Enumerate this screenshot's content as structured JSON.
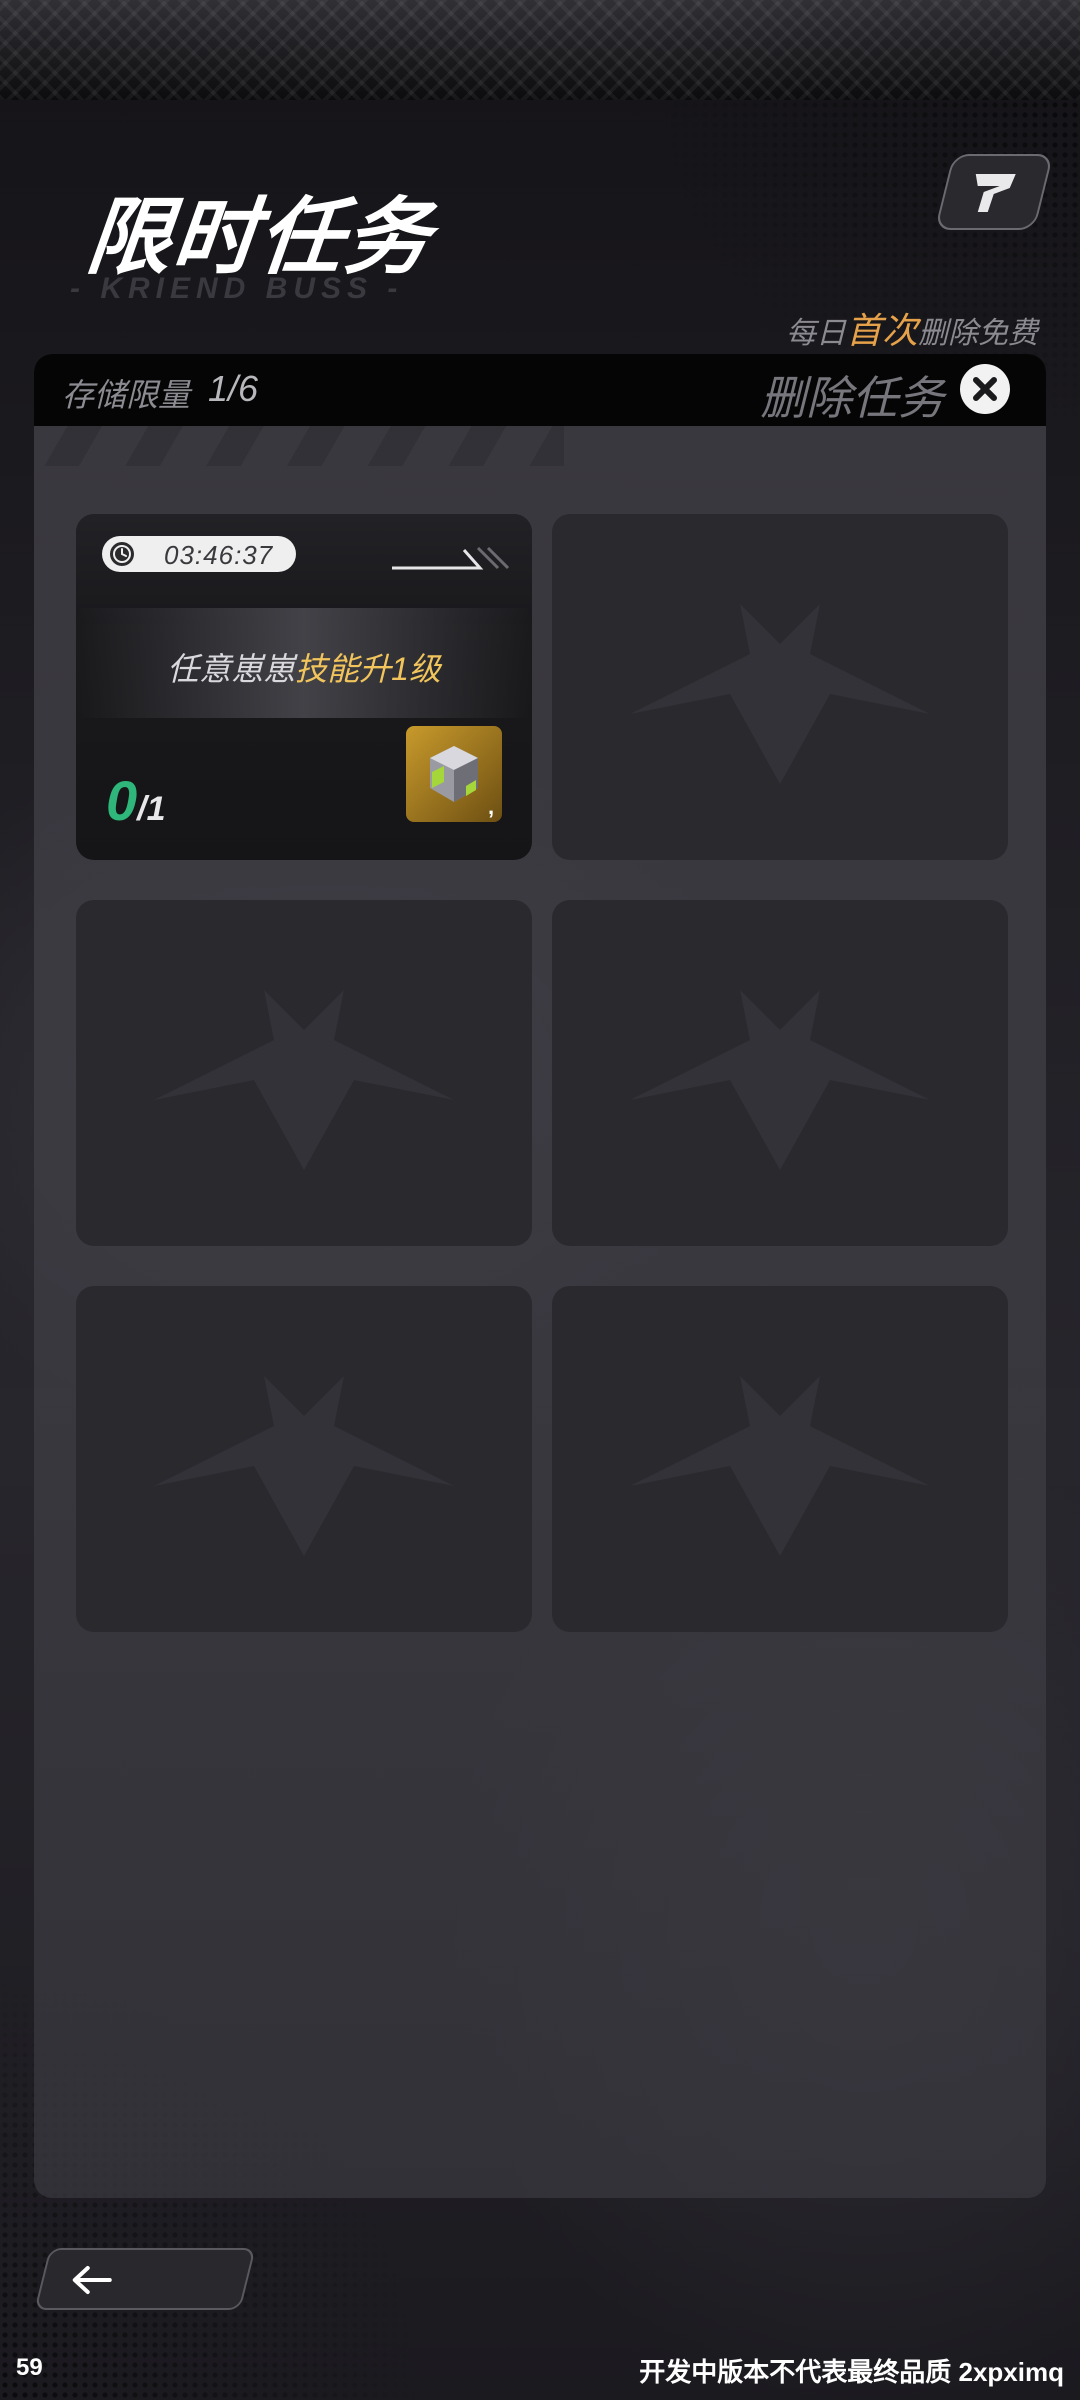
{
  "header": {
    "title": "限时任务",
    "subtitle": "- KRIEND BUSS -",
    "top_right_icon": "brand-logo-icon",
    "free_note": {
      "prefix": "每日",
      "highlight": "首次",
      "suffix": "删除免费"
    }
  },
  "panel": {
    "storage_label": "存储限量",
    "storage_value": "1/6",
    "delete_label": "删除任务",
    "close_icon": "close-icon"
  },
  "tasks": [
    {
      "timer": "03:46:37",
      "mission_prefix": "任意崽崽",
      "mission_highlight": "技能升1级",
      "progress_current": "0",
      "progress_separator": "/",
      "progress_total": "1",
      "reward_icon": "reward-cube-icon",
      "reward_count": ","
    }
  ],
  "empty_slots": 5,
  "footer": {
    "back_icon": "back-arrow-icon",
    "fps": "59",
    "build_note": "开发中版本不代表最终品质 2xpximq"
  },
  "colors": {
    "accent_orange": "#e6a24a",
    "accent_yellow": "#f1c45c",
    "progress_green": "#2fb67a"
  }
}
